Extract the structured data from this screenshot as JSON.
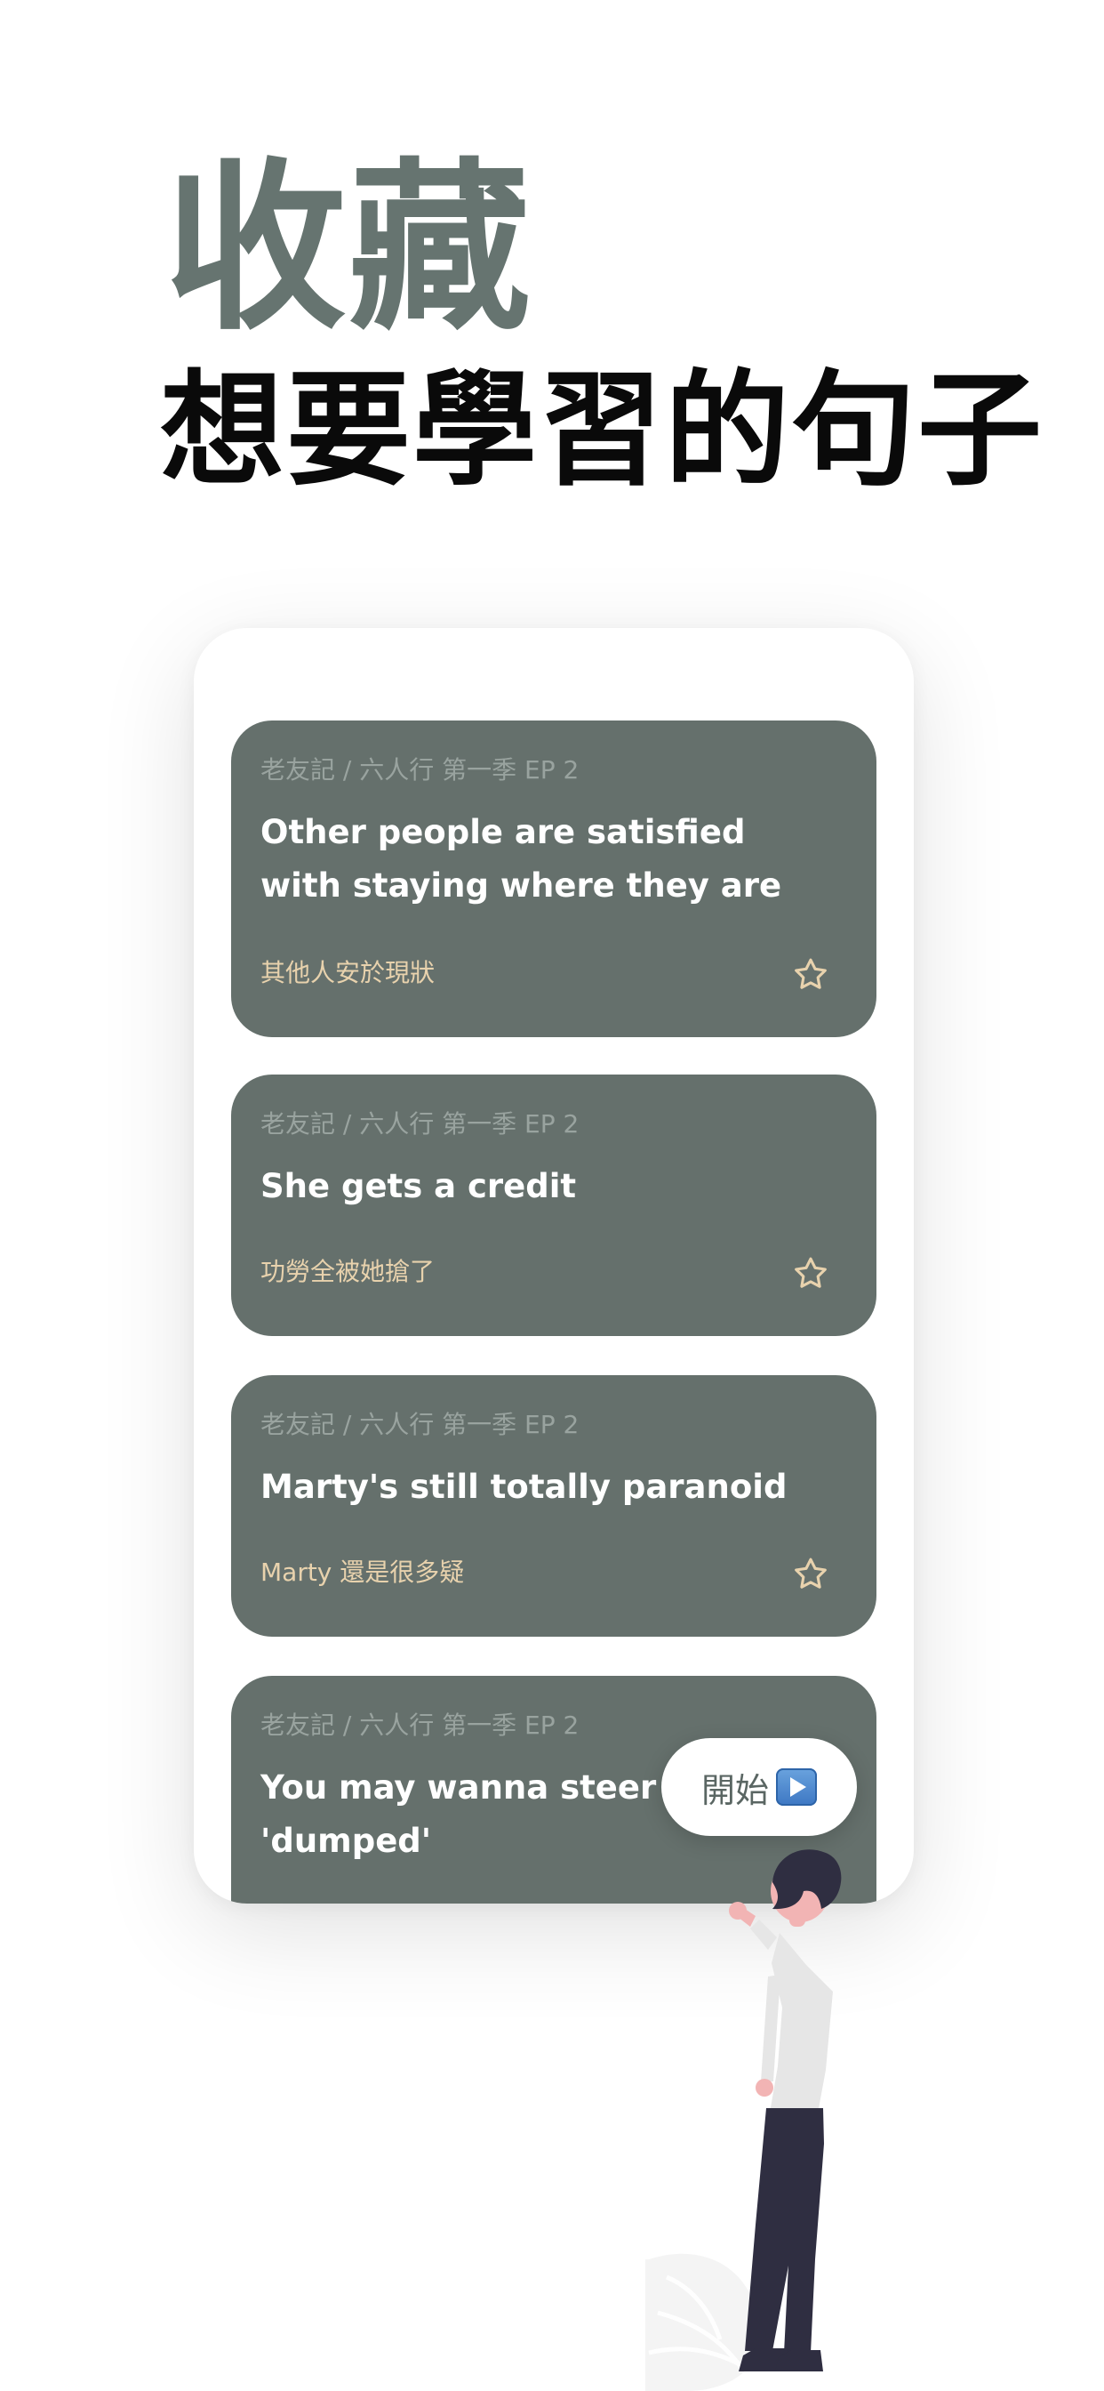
{
  "header": {
    "title": "收藏",
    "subtitle": "想要學習的句子"
  },
  "cards": [
    {
      "source": "老友記 / 六人行 第一季 EP 2",
      "english": "Other people are satisfied with staying where they are",
      "chinese": "其他人安於現狀",
      "icon": "star-outline-icon"
    },
    {
      "source": "老友記 / 六人行 第一季 EP 2",
      "english": "She gets a credit",
      "chinese": "功勞全被她搶了",
      "icon": "star-outline-icon"
    },
    {
      "source": "老友記 / 六人行 第一季 EP 2",
      "english": "Marty's still totally paranoid",
      "chinese": "Marty 還是很多疑",
      "icon": "star-outline-icon"
    },
    {
      "source": "老友記 / 六人行 第一季 EP 2",
      "english": "You may wanna steer cle word 'dumped'"
    }
  ],
  "start_button": {
    "label": "開始",
    "icon": "play-button-icon"
  },
  "colors": {
    "headline": "#667470",
    "card_background": "#65706c",
    "card_meta": "#99a39f",
    "card_translation": "#e8d2ad",
    "star": "#e8d2ad"
  }
}
